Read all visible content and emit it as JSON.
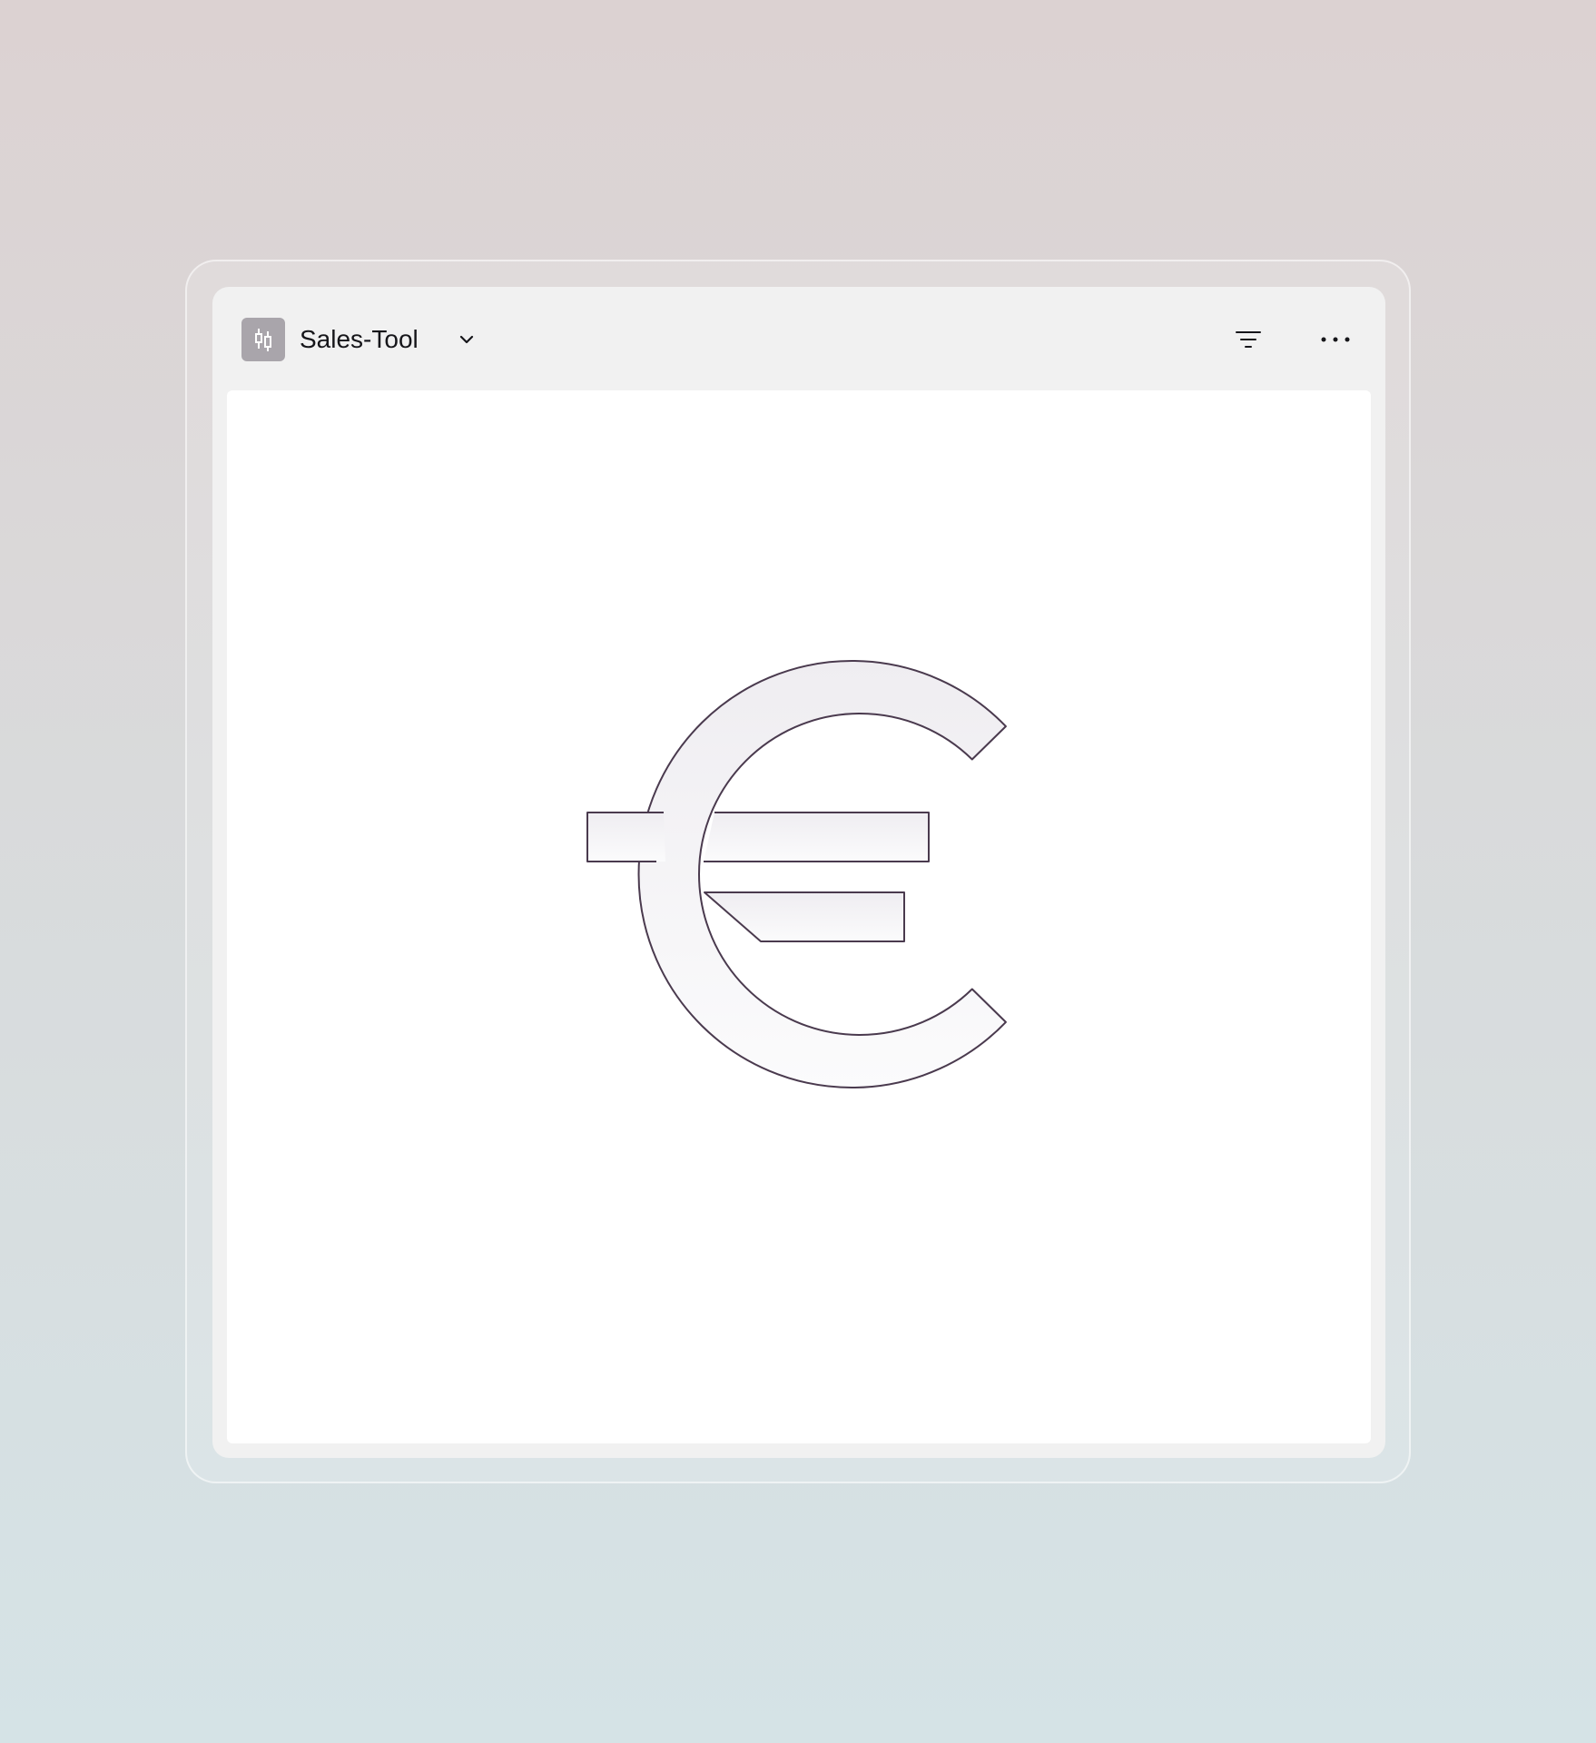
{
  "widget": {
    "title": "Sales-Tool",
    "app_icon": "candlestick-chart-icon",
    "dropdown_icon": "chevron-down-icon",
    "actions": [
      {
        "name": "filter",
        "icon": "filter-icon"
      },
      {
        "name": "more",
        "icon": "more-horizontal-icon"
      }
    ]
  },
  "content": {
    "illustration": "euro-icon"
  },
  "colors": {
    "app_icon_bg": "#a9a5ab",
    "widget_bg": "#f1f1f1",
    "content_bg": "#ffffff",
    "euro_stroke": "#4a3a4e"
  }
}
